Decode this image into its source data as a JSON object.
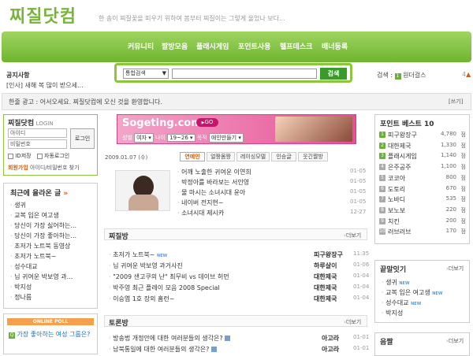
{
  "header": {
    "logo": "찌질닷컴",
    "slogan": "한 송이 찌질꽃을 피우기 위하여 봄부터 찌질이는 그렇게 울었나 보다..."
  },
  "nav": [
    "커뮤니티",
    "짤방모음",
    "플래시게임",
    "포인트사용",
    "헬프데스크",
    "배너등록"
  ],
  "search": {
    "select": "통합검색",
    "button": "검색",
    "rank_label": "검색 :",
    "rank_num": "1",
    "rank_text": "원더걸스",
    "rank_change": "4"
  },
  "notice": {
    "title": "공지사항",
    "text": "[인사] 새해 복 많이 받으세..."
  },
  "ad_bar": {
    "text": "한줄 광고 : 어서오세요. 찌질닷컴에 오신 것을 환영합니다.",
    "write": "[쓰기]"
  },
  "login": {
    "title": "찌질닷컴",
    "title_sub": "LOGIN",
    "id_placeholder": "아이디",
    "pw_placeholder": "비밀번호",
    "button": "로그인",
    "save_id": "ID저장",
    "auto_login": "자동로그인",
    "signup": "회원가입",
    "find": "아이디/비밀번호 찾기"
  },
  "recent": {
    "title": "최근에 올라온 글",
    "items": [
      "생귀",
      "교복 입은 여고생",
      "당신이 가장 싫어하는...",
      "당신이 가장 좋아하는...",
      "초저가 노트북 동영상",
      "초저가 노트북~",
      "성수대교",
      "님 귀여운 박보영 과...",
      "박지성",
      "정나름"
    ]
  },
  "poll": {
    "title": "ONLINE POLL",
    "question": "가장 좋아하는 여성 그룹은?"
  },
  "banner": {
    "brand": "Sogeting.com",
    "go": "GO",
    "gender_label": "성별",
    "gender": "여자",
    "age_label": "나이",
    "age": "19~26",
    "purpose_label": "목적",
    "purpose": "애인만들기"
  },
  "date": "2009.01.07 (수)",
  "tabs": [
    "연예인",
    "얼짱몸짱",
    "레이싱모델",
    "인승글",
    "웃긴짤방"
  ],
  "celebs": [
    {
      "title": "어깨 노출한 귀여운 이연희",
      "date": "01-05"
    },
    {
      "title": "박정아를 바라보는 서인영",
      "date": "01-05"
    },
    {
      "title": "물 마시는 소녀시대 윤아",
      "date": "01-05"
    },
    {
      "title": "네이버 전지현~",
      "date": "01-05"
    },
    {
      "title": "소녀시대 제시카",
      "date": "12-27"
    }
  ],
  "jjil": {
    "title": "찌질방",
    "more": "더보기",
    "items": [
      {
        "title": "초저가 노트북~",
        "new": true,
        "author": "피구왕장구",
        "date": "11:35"
      },
      {
        "title": "님 귀여운 박보영 과거사진",
        "new": false,
        "author": "하루살이",
        "date": "01-06"
      },
      {
        "title": "\"2009 샌고쿠의 난\" 최무비 vs 데이브 허먼",
        "new": false,
        "author": "대한제국",
        "date": "01-04"
      },
      {
        "title": "박주영 최근 플레이 모음 2008 Special",
        "new": false,
        "author": "대한제국",
        "date": "01-04"
      },
      {
        "title": "이승엽 1호 장외 홈런~",
        "new": false,
        "author": "대한제국",
        "date": "01-04"
      }
    ]
  },
  "debate": {
    "title": "토론방",
    "more": "더보기",
    "items": [
      {
        "title": "방송법 개정안에 대한 여러분들의 생각은?",
        "author": "아고라",
        "date": "01-01"
      },
      {
        "title": "남북통일에 대한 여러분들의 생각은?",
        "author": "아고라",
        "date": "01-01"
      }
    ]
  },
  "points": {
    "title": "포인트 베스트 10",
    "items": [
      {
        "rank": "1",
        "name": "피구왕장구",
        "score": "4,780",
        "unit": "점"
      },
      {
        "rank": "2",
        "name": "대한제국",
        "score": "1,330",
        "unit": "점"
      },
      {
        "rank": "3",
        "name": "플래시게임",
        "score": "1,140",
        "unit": "점"
      },
      {
        "rank": "4",
        "name": "은주공주",
        "score": "1,100",
        "unit": "점"
      },
      {
        "rank": "5",
        "name": "코코아",
        "score": "800",
        "unit": "점"
      },
      {
        "rank": "6",
        "name": "도토리",
        "score": "670",
        "unit": "점"
      },
      {
        "rank": "7",
        "name": "노바디",
        "score": "535",
        "unit": "점"
      },
      {
        "rank": "8",
        "name": "보노보",
        "score": "220",
        "unit": "점"
      },
      {
        "rank": "9",
        "name": "치킨",
        "score": "200",
        "unit": "점"
      },
      {
        "rank": "10",
        "name": "러브러브",
        "score": "170",
        "unit": "점"
      }
    ]
  },
  "relay": {
    "title": "끝말잇기",
    "more": "더보기",
    "items": [
      {
        "title": "생귀",
        "new": true
      },
      {
        "title": "교복 입은 여고생",
        "new": true
      },
      {
        "title": "성수대교",
        "new": true
      },
      {
        "title": "박지성",
        "new": false
      }
    ]
  },
  "bottom_right": {
    "title": "음짤",
    "more": "더보기"
  },
  "new_mark": "NEW",
  "colors": {
    "brand_green": "#8cc63f",
    "accent_orange": "#e05a00",
    "pink": "#e84a9a"
  }
}
